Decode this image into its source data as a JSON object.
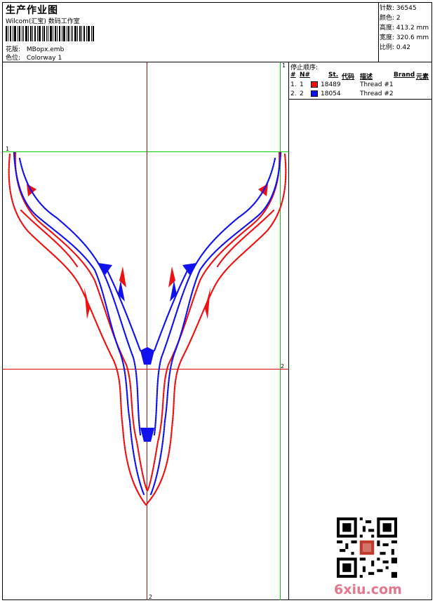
{
  "header": {
    "title": "生产作业图",
    "subtitle": "Wilcom(汇宝) 数码工作室",
    "design_label": "花版:",
    "design_value": "MBopx.emb",
    "colorway_label": "色位:",
    "colorway_value": "Colorway 1"
  },
  "stats": [
    {
      "label": "针数:",
      "value": "36545"
    },
    {
      "label": "颜色:",
      "value": "2"
    },
    {
      "label": "高度:",
      "value": "413.2 mm"
    },
    {
      "label": "宽度:",
      "value": "320.6 mm"
    },
    {
      "label": "比例:",
      "value": "0.42"
    }
  ],
  "stop_sequence": {
    "title": "停止顺序:",
    "headers": {
      "num": "#",
      "n": "N#",
      "st": "St.",
      "code": "代码",
      "desc": "描述",
      "brand": "Brand",
      "element": "元素"
    },
    "rows": [
      {
        "num": "1.",
        "n": "1",
        "color": "#ee1111",
        "code": "18489",
        "desc": "Thread #1"
      },
      {
        "num": "2.",
        "n": "2",
        "color": "#1111ee",
        "code": "18054",
        "desc": "Thread #2"
      }
    ]
  },
  "guides": {
    "top_left": "1",
    "top_right": "1",
    "right_mid": "2",
    "bottom": "2"
  },
  "colors": {
    "red": "#ee1111",
    "blue": "#1111ee",
    "green_guide": "#00cc00",
    "red_guide": "#dd0000",
    "watermark": "#e2788a"
  },
  "watermark": "6xiu.com"
}
